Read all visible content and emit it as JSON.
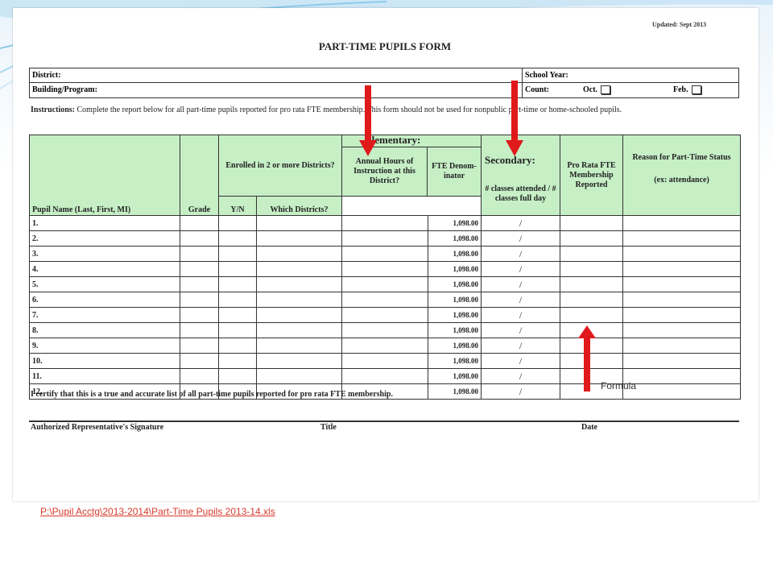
{
  "updated": "Updated: Sept 2013",
  "form_title": "PART-TIME PUPILS FORM",
  "header": {
    "district_label": "District:",
    "school_year_label": "School Year:",
    "building_label": "Building/Program:",
    "count_label": "Count:",
    "oct_label": "Oct.",
    "feb_label": "Feb."
  },
  "instructions": {
    "lead": "Instructions:",
    "text": "  Complete the report below for all part-time pupils reported for pro rata FTE membership.  This form should not be used for nonpublic part-time or home-schooled pupils."
  },
  "table": {
    "group_headers": {
      "enrolled": "Enrolled in 2 or more Districts?",
      "elementary": "Elementary:",
      "secondary": "Secondary:"
    },
    "columns": {
      "name": "Pupil Name (Last, First, MI)",
      "grade": "Grade",
      "yn": "Y/N",
      "which": "Which Districts?",
      "hours": "Annual Hours of Instruction at this District?",
      "fte": "FTE Denom-inator",
      "classes": "# classes attended / # classes full day",
      "prorata": "Pro Rata FTE Membership Reported",
      "reason": "Reason for Part-Time Status",
      "reason_ex": "(ex:  attendance)"
    },
    "rows": [
      {
        "num": "1.",
        "fte": "1,098.00",
        "slash": "/"
      },
      {
        "num": "2.",
        "fte": "1,098.00",
        "slash": "/"
      },
      {
        "num": "3.",
        "fte": "1,098.00",
        "slash": "/"
      },
      {
        "num": "4.",
        "fte": "1,098.00",
        "slash": "/"
      },
      {
        "num": "5.",
        "fte": "1,098.00",
        "slash": "/"
      },
      {
        "num": "6.",
        "fte": "1,098.00",
        "slash": "/"
      },
      {
        "num": "7.",
        "fte": "1,098.00",
        "slash": "/"
      },
      {
        "num": "8.",
        "fte": "1,098.00",
        "slash": "/"
      },
      {
        "num": "9.",
        "fte": "1,098.00",
        "slash": "/"
      },
      {
        "num": "10.",
        "fte": "1,098.00",
        "slash": "/"
      },
      {
        "num": "11.",
        "fte": "1,098.00",
        "slash": "/"
      },
      {
        "num": "12.",
        "fte": "1,098.00",
        "slash": "/"
      }
    ]
  },
  "certify": "I certify that this is a true and accurate list of all part-time pupils reported for pro rata FTE membership.",
  "signature": {
    "sig_label": "Authorized Representative's Signature",
    "title_label": "Title",
    "date_label": "Date"
  },
  "annotation": {
    "formula_label": "Formula",
    "arrow_color": "#e0191b"
  },
  "file_link": "P:\\Pupil Acctg\\2013-2014\\Part-Time Pupils 2013-14.xls"
}
